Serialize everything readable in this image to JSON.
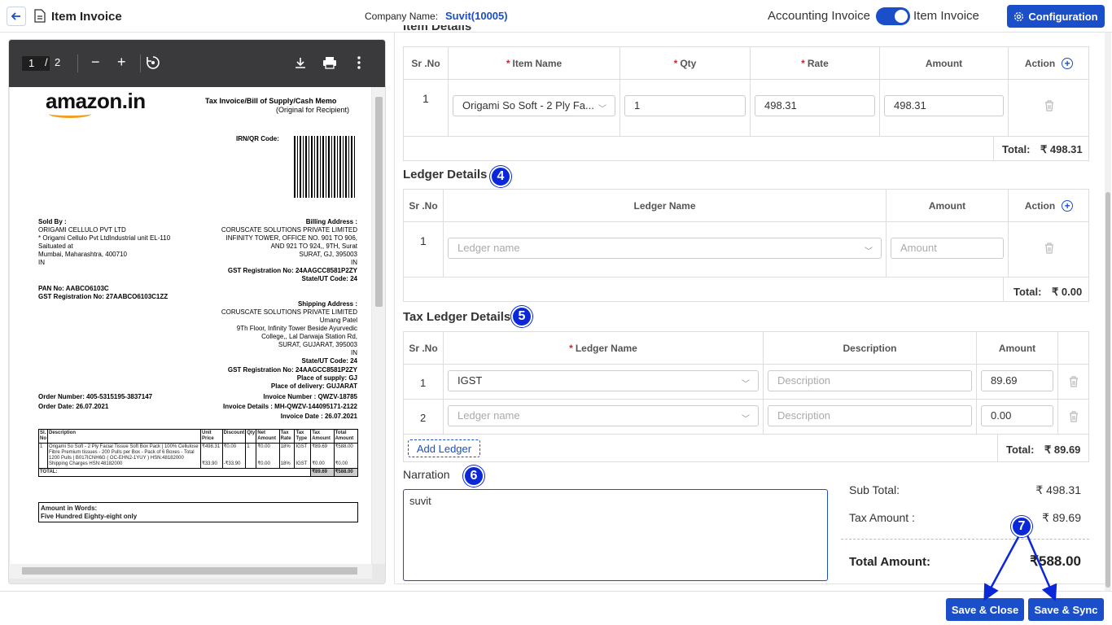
{
  "header": {
    "title": "Item Invoice",
    "company_label": "Company Name:",
    "company_value": "Suvit(10005)",
    "accounting_invoice": "Accounting Invoice",
    "item_invoice": "Item Invoice",
    "configuration": "Configuration"
  },
  "pdf": {
    "page_current": "1",
    "page_sep": "/",
    "page_total": "2",
    "logo": "amazon.in",
    "invoice_title": "Tax Invoice/Bill of Supply/Cash Memo",
    "invoice_subtitle": "(Original for Recipient)",
    "irn_label": "IRN/QR Code:",
    "sold_by_label": "Sold By :",
    "sold_by_lines": [
      "ORIGAMI CELLULO PVT LTD",
      "* Origami Cellulo Pvt LtdIndustrial unit EL-110",
      "Saituated at",
      "Mumbai, Maharashtra, 400710",
      "IN"
    ],
    "billing_label": "Billing Address :",
    "billing_lines": [
      "CORUSCATE SOLUTIONS PRIVATE LIMITED",
      "INFINITY TOWER, OFFICE NO. 901 TO 906,",
      "AND 921 TO 924,, 9TH, Surat",
      "SURAT, GJ, 395003",
      "IN"
    ],
    "gst_billing": "GST Registration No: 24AAGCC8581P2ZY",
    "state_billing": "State/UT Code: 24",
    "pan": "PAN No: AABCO6103C",
    "gst_seller": "GST Registration No: 27AABCO6103C1ZZ",
    "shipping_label": "Shipping Address :",
    "shipping_lines": [
      "CORUSCATE SOLUTIONS PRIVATE LIMITED",
      "Umang Patel",
      "9Th Floor, Infinity Tower Beside Ayurvedic",
      "College,, Lal Darwaja Station Rd,",
      "SURAT, GUJARAT, 395003",
      "IN"
    ],
    "state_shipping": "State/UT Code: 24",
    "gst_shipping": "GST Registration No: 24AAGCC8581P2ZY",
    "place_supply": "Place of supply: GJ",
    "place_delivery": "Place of delivery: GUJARAT",
    "order_number": "Order Number: 405-5315195-3837147",
    "order_date": "Order Date: 26.07.2021",
    "invoice_number": "Invoice Number : QWZV-18785",
    "invoice_details": "Invoice Details : MH-QWZV-144095171-2122",
    "invoice_date": "Invoice Date : 26.07.2021",
    "table_headers": [
      "Sl. No",
      "Description",
      "Unit Price",
      "Discount",
      "Qty",
      "Net Amount",
      "Tax Rate",
      "Tax Type",
      "Tax Amount",
      "Total Amount"
    ],
    "row1": {
      "sl": "1",
      "desc": "Origami So Soft - 2 Ply Facial Tissue Soft Box Pack | 100% Cellulose Fibre Premium tissues - 200 Pulls per Box - Pack of 6 Boxes - Total 1200 Pulls | B017ICNH6G ( OC-EHN2-1YUY ) HSN:48182000",
      "unit": "₹498.31",
      "disc": "₹0.00",
      "qty": "1",
      "net": "₹0.00",
      "rate": "18%",
      "type": "IGST",
      "tax": "₹89.69",
      "total": "₹588.00"
    },
    "row2": {
      "desc": "Shipping Charges HSN:48182000",
      "unit": "₹33.90",
      "disc": "-₹33.90",
      "net": "₹0.00",
      "rate": "18%",
      "type": "IGST",
      "tax": "₹0.00",
      "total": "₹0.00"
    },
    "total_label": "TOTAL:",
    "total_tax": "₹89.69",
    "total_amount": "₹588.00",
    "words_label": "Amount in Words:",
    "words_value": "Five Hundred Eighty-eight only"
  },
  "item_details": {
    "title": "Item Details",
    "headers": {
      "srno": "Sr .No",
      "item_name": "Item Name",
      "qty": "Qty",
      "rate": "Rate",
      "amount": "Amount",
      "action": "Action"
    },
    "row": {
      "srno": "1",
      "item_name": "Origami So Soft - 2 Ply Fa...",
      "qty": "1",
      "rate": "498.31",
      "amount": "498.31"
    },
    "total_label": "Total:",
    "total_value": "₹ 498.31"
  },
  "ledger_details": {
    "title": "Ledger Details",
    "badge": "4",
    "headers": {
      "srno": "Sr .No",
      "ledger_name": "Ledger Name",
      "amount": "Amount",
      "action": "Action"
    },
    "row": {
      "srno": "1",
      "ledger_placeholder": "Ledger name",
      "amount_placeholder": "Amount"
    },
    "total_label": "Total:",
    "total_value": "₹ 0.00"
  },
  "tax_ledger_details": {
    "title": "Tax Ledger Details",
    "badge": "5",
    "headers": {
      "srno": "Sr .No",
      "ledger_name": "Ledger Name",
      "description": "Description",
      "amount": "Amount"
    },
    "rows": [
      {
        "srno": "1",
        "ledger": "IGST",
        "description_placeholder": "Description",
        "amount": "89.69"
      },
      {
        "srno": "2",
        "ledger_placeholder": "Ledger name",
        "description_placeholder": "Description",
        "amount": "0.00"
      }
    ],
    "add_ledger": "Add Ledger",
    "total_label": "Total:",
    "total_value": "₹ 89.69"
  },
  "narration": {
    "title": "Narration",
    "badge": "6",
    "value": "suvit"
  },
  "summary": {
    "sub_total_label": "Sub Total:",
    "sub_total_value": "₹ 498.31",
    "tax_amount_label": "Tax Amount :",
    "tax_amount_value": "₹ 89.69",
    "total_amount_label": "Total Amount:",
    "total_amount_value": "₹588.00",
    "badge": "7"
  },
  "footer": {
    "save_close": "Save & Close",
    "save_sync": "Save & Sync"
  },
  "colors": {
    "primary": "#1a4fc9",
    "badge": "#0b28d8",
    "required": "#e02020"
  }
}
